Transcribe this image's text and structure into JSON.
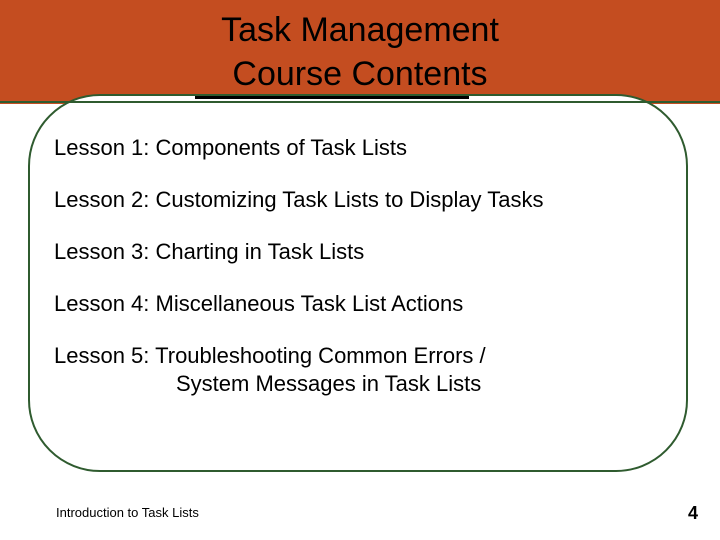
{
  "title_line1": "Task Management",
  "title_line2": "Course Contents",
  "lessons": {
    "l1": "Lesson 1: Components of Task Lists",
    "l2": "Lesson 2: Customizing Task Lists to Display Tasks",
    "l3": "Lesson 3: Charting in Task Lists",
    "l4": "Lesson 4: Miscellaneous Task List Actions",
    "l5a": "Lesson 5: Troubleshooting Common Errors /",
    "l5b": "System Messages in Task Lists"
  },
  "footer": {
    "left": "Introduction to Task Lists",
    "page": "4"
  }
}
